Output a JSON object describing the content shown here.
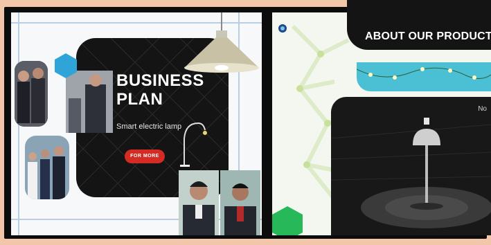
{
  "left_slide": {
    "title_line1": "BUSINESS",
    "title_line2": "PLAN",
    "subtitle": "Smart electric lamp",
    "cta_label": "FOR MORE"
  },
  "right_slide": {
    "header_title": "ABOUT OUR PRODUCT",
    "corner_text": "No",
    "logo_line1": "",
    "logo_line2": ""
  },
  "colors": {
    "accent_red": "#d42b25",
    "accent_cyan": "#4bbfd3",
    "hex_blue": "#2ea4d8",
    "hex_green": "#27b85a"
  },
  "icons": [
    "pendant-lamp-icon",
    "desk-lamp-icon",
    "hexagon-icon",
    "mushroom-lamp-icon",
    "logo-icon"
  ]
}
